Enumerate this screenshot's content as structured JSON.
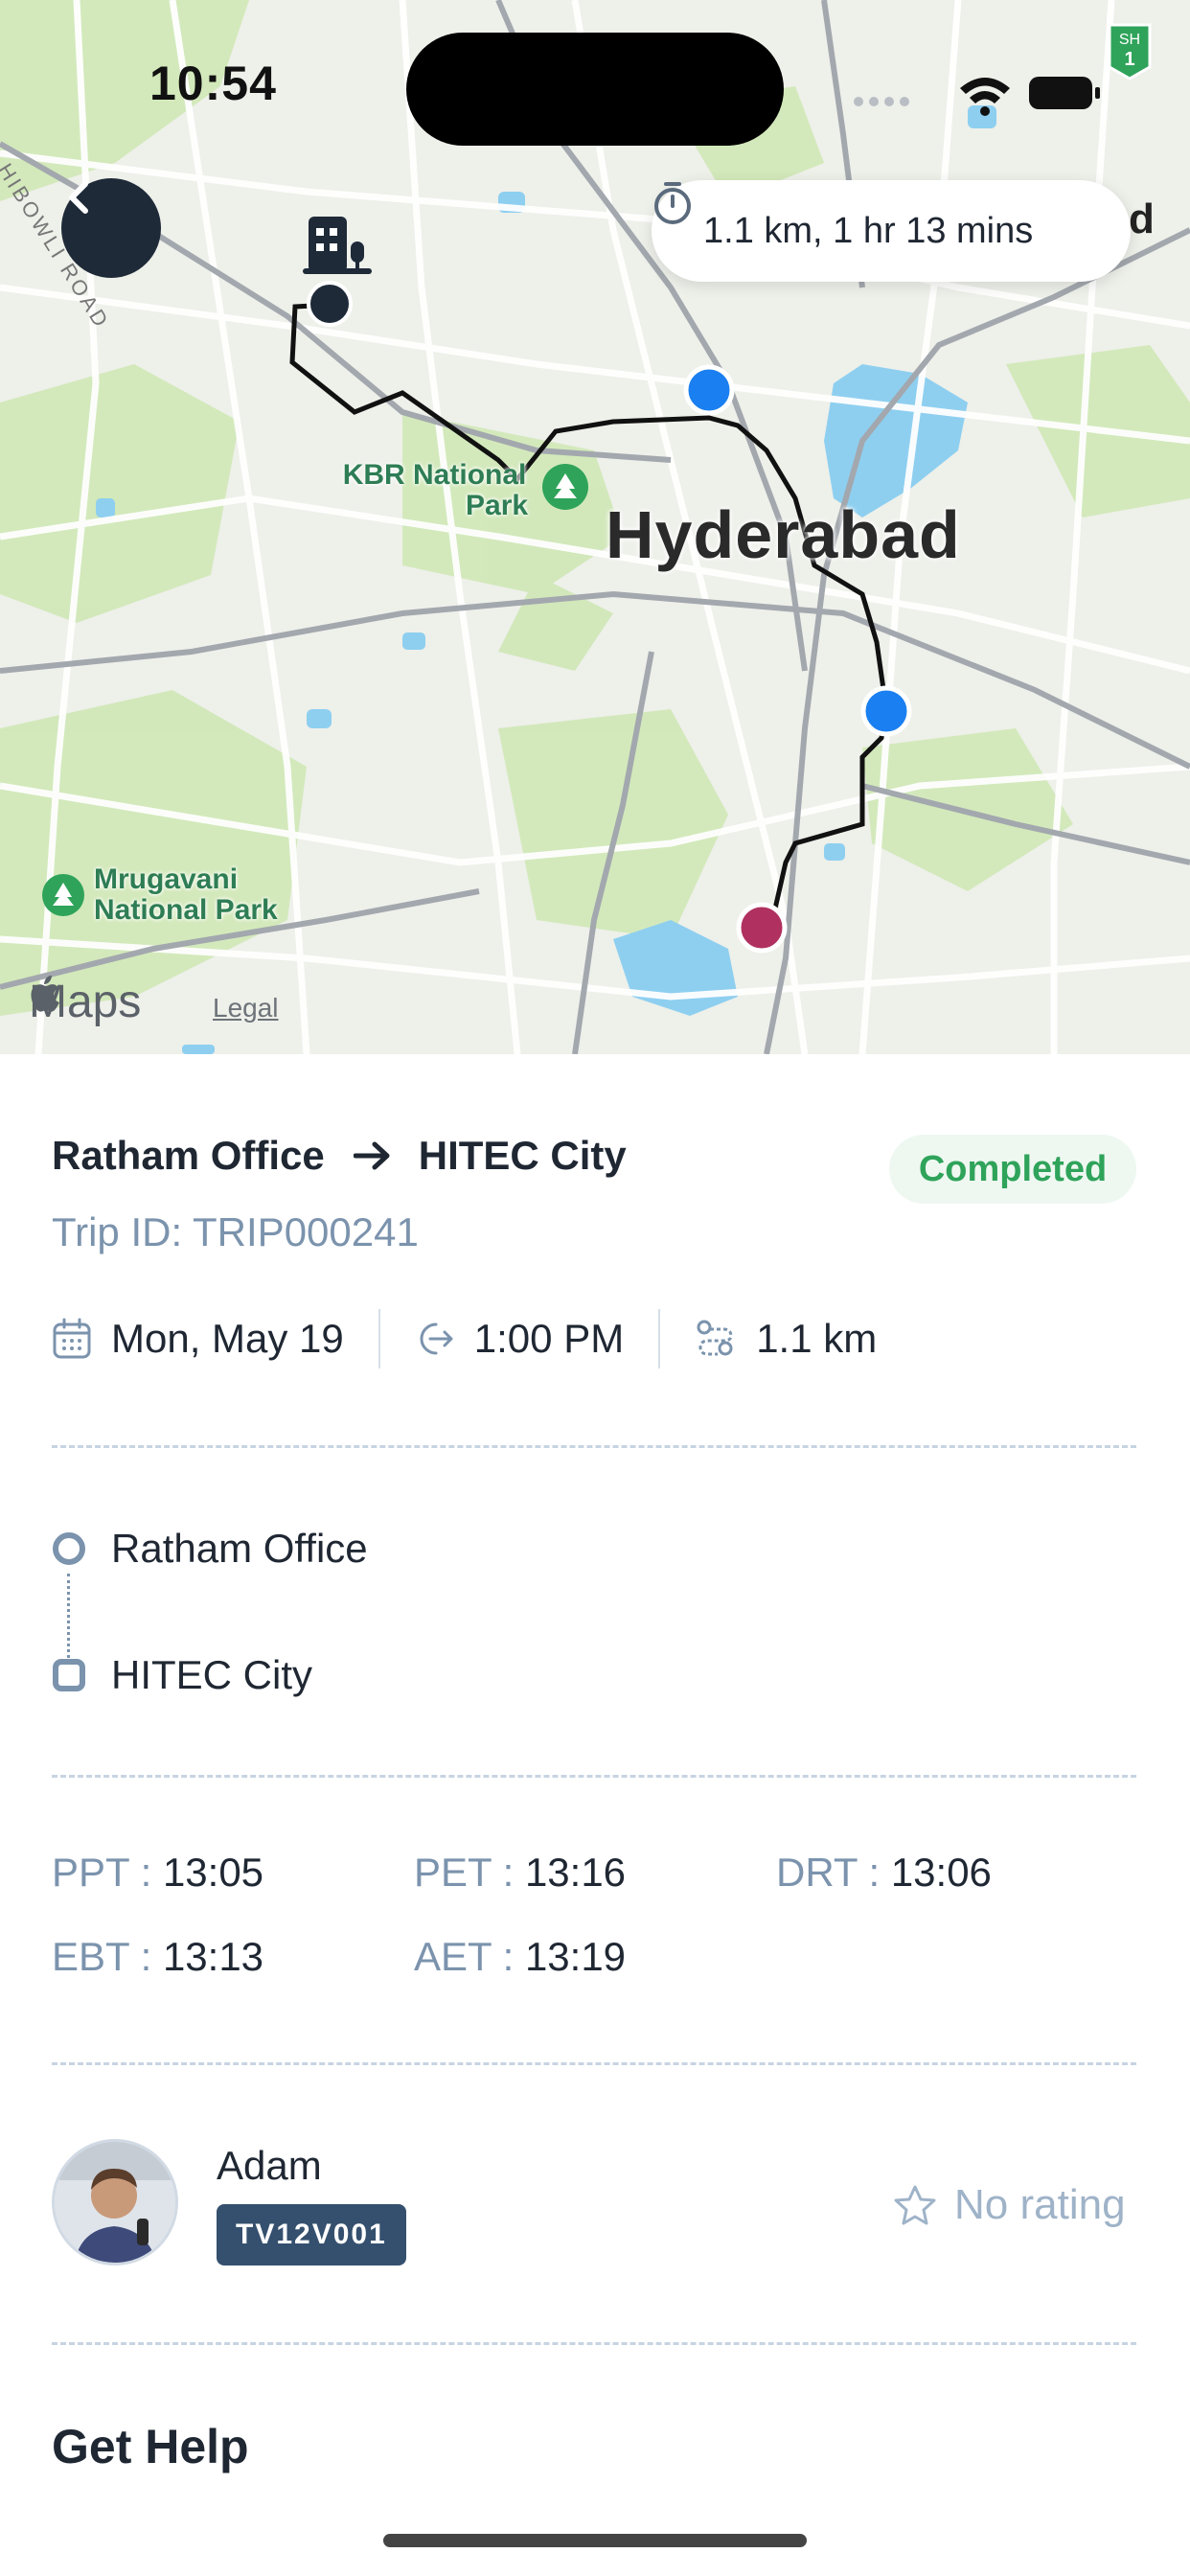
{
  "status_bar": {
    "time": "10:54"
  },
  "map": {
    "eta": "1.1 km, 1 hr 13 mins",
    "city_label": "Hyderabad",
    "cut_label": "d",
    "parks": [
      "KBR National Park",
      "Mrugavani National Park"
    ],
    "park_lines": {
      "kbr_1": "KBR National",
      "kbr_2": "Park",
      "mru_1": "Mrugavani",
      "mru_2": "National Park"
    },
    "road_label": "HIBOWLI ROAD",
    "highway_shield": {
      "line1": "SH",
      "line2": "1"
    },
    "brand": "Maps",
    "legal": "Legal"
  },
  "trip": {
    "from": "Ratham Office",
    "to": "HITEC City",
    "status": "Completed",
    "trip_id": "Trip ID: TRIP000241",
    "date": "Mon, May 19",
    "time": "1:00 PM",
    "distance": "1.1 km"
  },
  "stops": {
    "pickup": "Ratham Office",
    "drop": "HITEC City"
  },
  "times": {
    "ppt": {
      "key": "PPT :",
      "value": "13:05"
    },
    "pet": {
      "key": "PET :",
      "value": "13:16"
    },
    "drt": {
      "key": "DRT :",
      "value": "13:06"
    },
    "ebt": {
      "key": "EBT :",
      "value": "13:13"
    },
    "aet": {
      "key": "AET :",
      "value": "13:19"
    }
  },
  "driver": {
    "name": "Adam",
    "vehicle_no": "TV12V001",
    "rating": "No rating"
  },
  "help": {
    "title": "Get Help"
  },
  "colors": {
    "accent_dark": "#1e2a38",
    "status_green": "#2fa35a",
    "muted_blue": "#7b93ad",
    "plate_bg": "#35506e",
    "route_blue": "#1a7ff0",
    "route_end": "#b0305f"
  }
}
